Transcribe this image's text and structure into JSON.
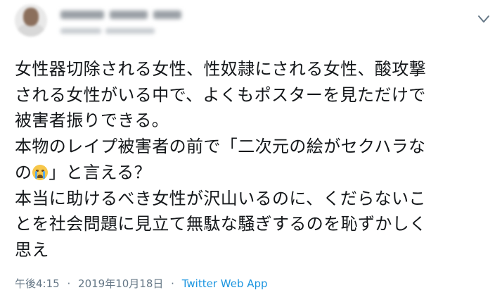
{
  "tweet": {
    "lines": [
      "女性器切除される女性、性奴隷にされる女性、酸攻撃",
      "される女性がいる中で、よくもポスターを見ただけで",
      "被害者振りできる。",
      "本物のレイプ被害者の前で「二次元の絵がセクハラな",
      "」と言える？",
      "本当に助けるべき女性が沢山いるのに、くだらないこ",
      "とを社会問題に見立て無駄な騒ぎするのを恥ずかしく",
      "思え"
    ],
    "line5_prefix": "の",
    "emoji_name": "loudly-crying-face",
    "time": "午後4:15",
    "separator": "·",
    "date": "2019年10月18日",
    "source": "Twitter Web App"
  },
  "colors": {
    "text": "#14171a",
    "meta": "#657786",
    "link": "#1b95e0",
    "chevron": "#657786"
  }
}
